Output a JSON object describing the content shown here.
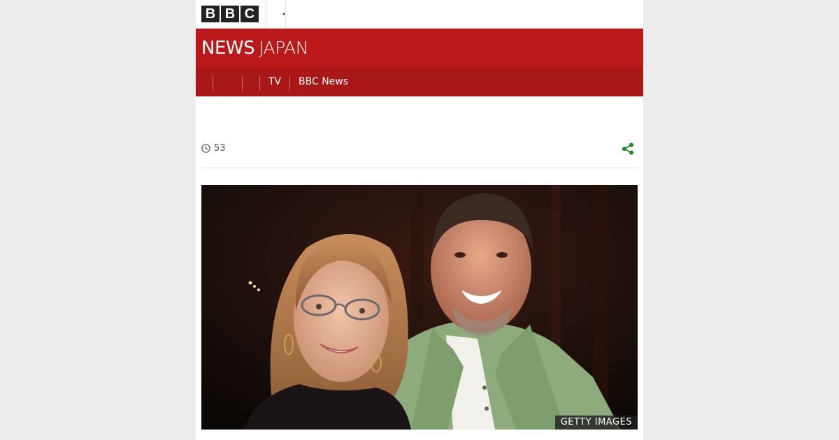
{
  "brand": {
    "logo_letters": [
      "B",
      "B",
      "C"
    ]
  },
  "masthead": {
    "title_main": "NEWS",
    "title_sub": "JAPAN",
    "background": "#bb1919"
  },
  "nav": {
    "items": [
      {
        "label": ""
      },
      {
        "label": ""
      },
      {
        "label": "TV"
      },
      {
        "label": "BBC News"
      }
    ],
    "background": "#a91717"
  },
  "article": {
    "timestamp": "53",
    "share_color": "#1f8a1f",
    "image_credit": "GETTY IMAGES"
  },
  "icons": {
    "clock": "clock-icon",
    "share": "share-icon",
    "menu_chevron": "chevron-down-icon"
  }
}
